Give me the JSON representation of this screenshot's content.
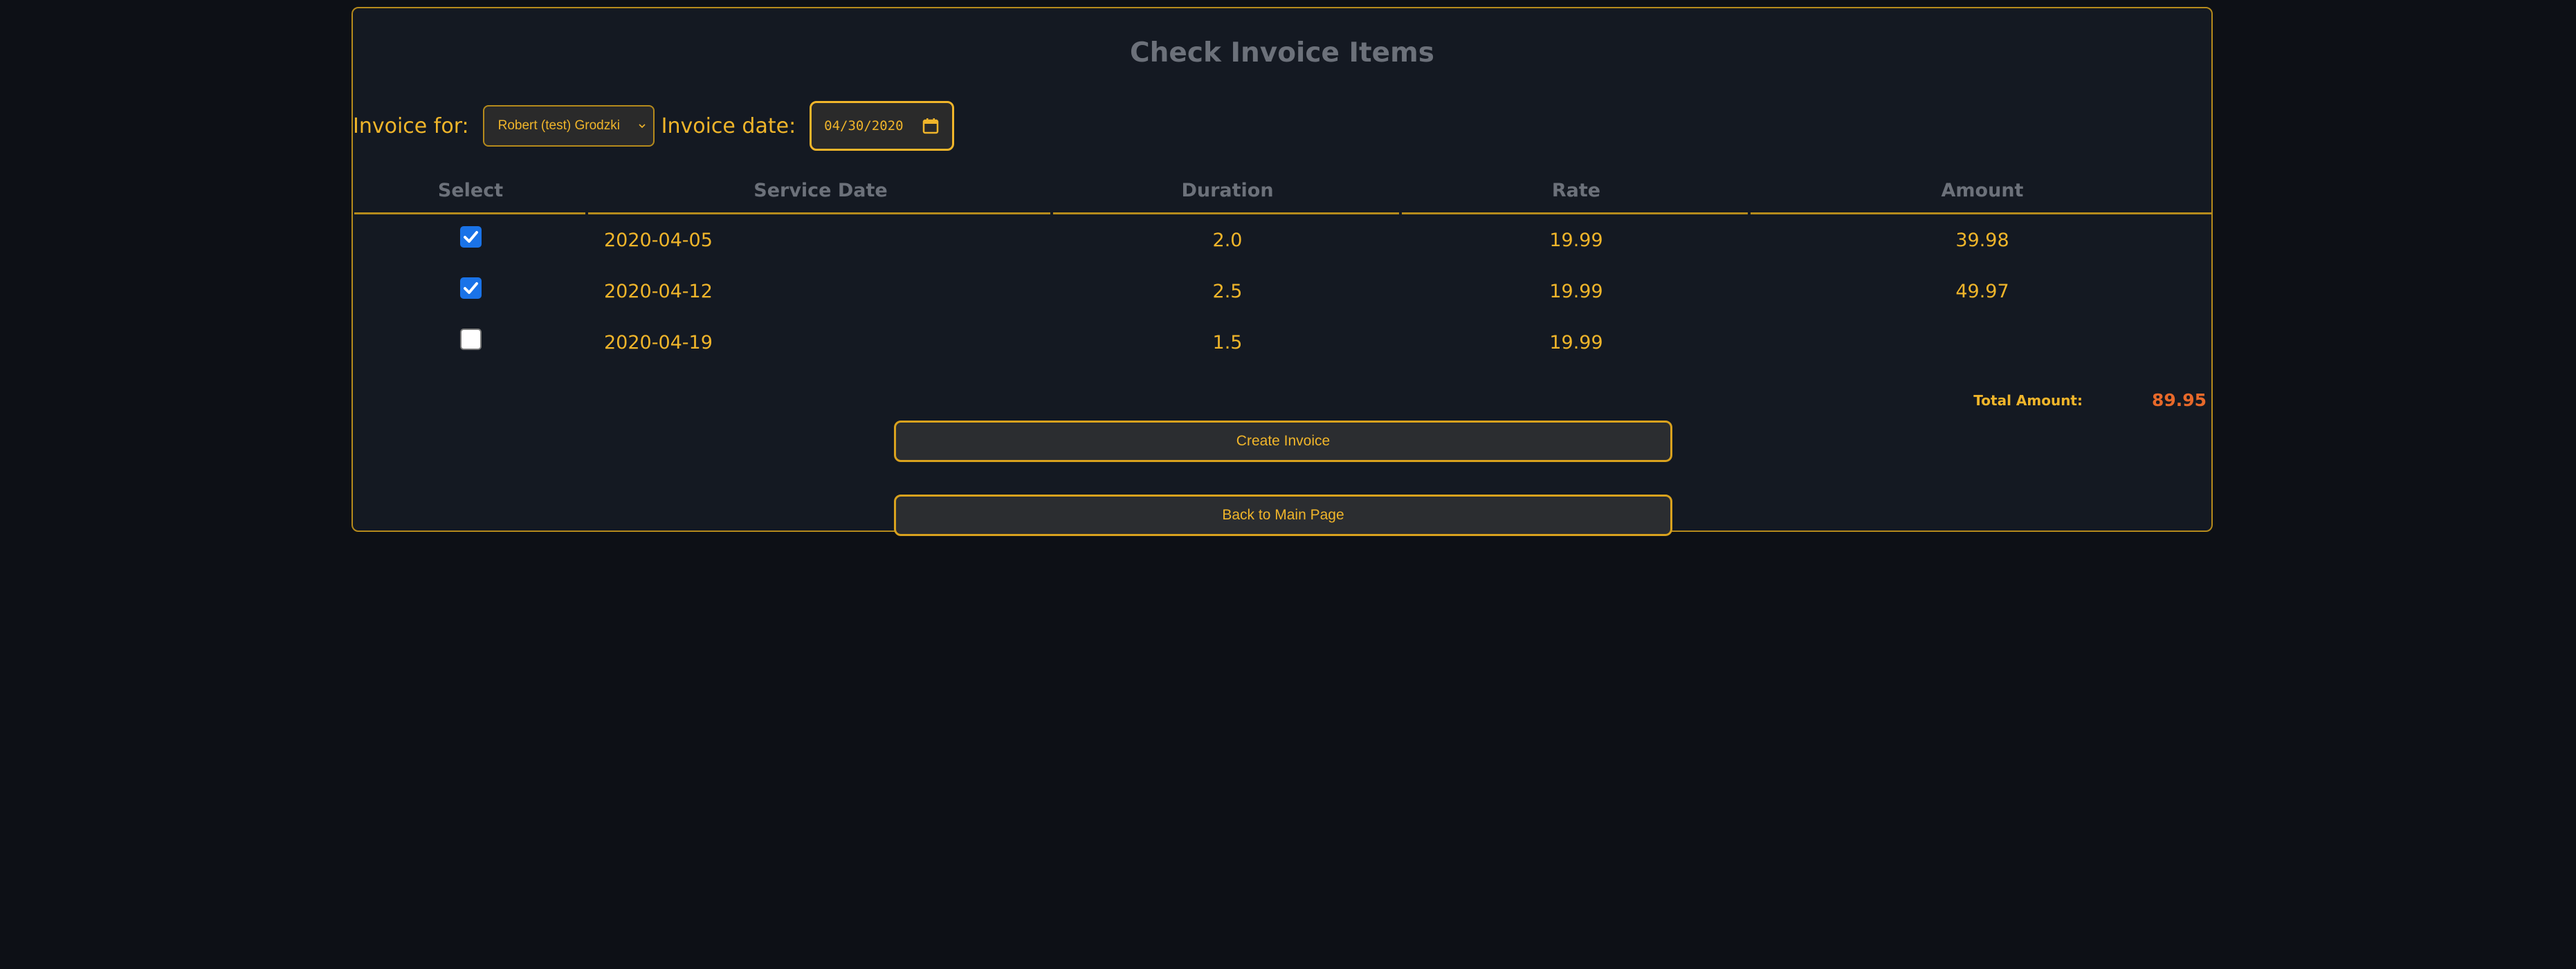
{
  "page": {
    "title": "Check Invoice Items"
  },
  "form": {
    "invoice_for_label": "Invoice for:",
    "invoice_for_value": "Robert (test) Grodzki",
    "invoice_date_label": "Invoice date:",
    "invoice_date_value": "04/30/2020"
  },
  "table": {
    "headers": [
      "Select",
      "Service Date",
      "Duration",
      "Rate",
      "Amount"
    ],
    "rows": [
      {
        "selected": true,
        "service_date": "2020-04-05",
        "duration": "2.0",
        "rate": "19.99",
        "amount": "39.98"
      },
      {
        "selected": true,
        "service_date": "2020-04-12",
        "duration": "2.5",
        "rate": "19.99",
        "amount": "49.97"
      },
      {
        "selected": false,
        "service_date": "2020-04-19",
        "duration": "1.5",
        "rate": "19.99",
        "amount": ""
      }
    ]
  },
  "totals": {
    "label": "Total Amount:",
    "value": "89.95"
  },
  "buttons": {
    "create_invoice": "Create Invoice",
    "back_to_main": "Back to Main Page"
  },
  "colors": {
    "accent": "#f0b52a",
    "border": "#b58a1c",
    "total": "#e8692a",
    "checkbox": "#1a73e8",
    "background": "#0d1016"
  }
}
